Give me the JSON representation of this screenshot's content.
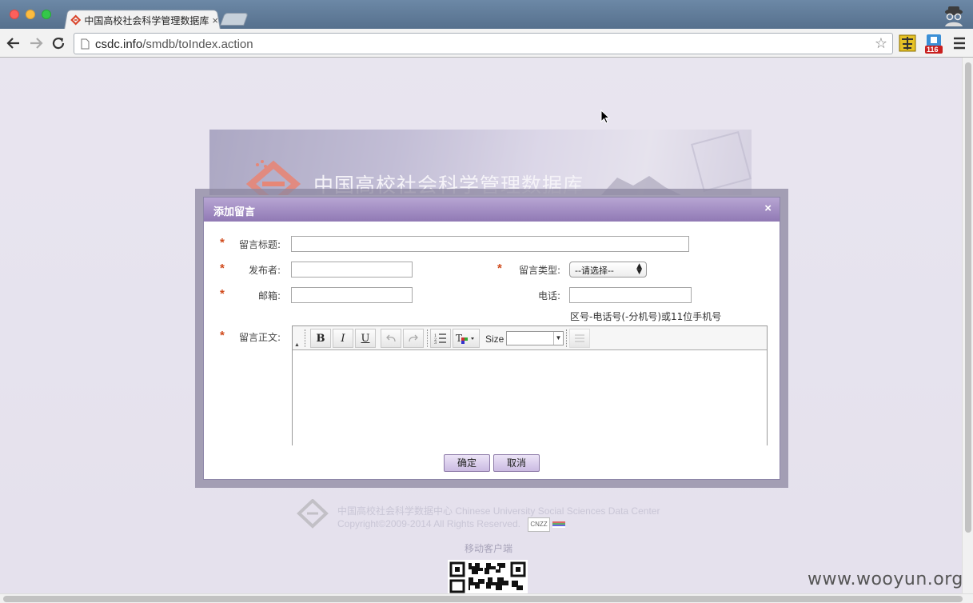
{
  "browser": {
    "tab_title": "中国高校社会科学管理数据库",
    "tab_close": "×",
    "url_host": "csdc.info",
    "url_path": "/smdb/toIndex.action",
    "extension_badge": "116"
  },
  "banner": {
    "title": "中国高校社会科学管理数据库"
  },
  "modal": {
    "title": "添加留言",
    "close": "×",
    "fields": {
      "subject_label": "留言标题:",
      "publisher_label": "发布者:",
      "type_label": "留言类型:",
      "type_value": "--请选择--",
      "email_label": "邮箱:",
      "phone_label": "电话:",
      "phone_hint": "区号-电话号(-分机号)或11位手机号",
      "body_label": "留言正文:",
      "required_mark": "*"
    },
    "editor": {
      "bold": "B",
      "italic": "I",
      "underline": "U",
      "size_label": "Size"
    },
    "buttons": {
      "confirm": "确定",
      "cancel": "取消"
    }
  },
  "footer": {
    "center_name": "中国高校社会科学数据中心 Chinese University Social Sciences Data Center",
    "copyright": "Copyright©2009-2014 All Rights Reserved.",
    "cnzz": "CNZZ",
    "mobile_label": "移动客户端"
  },
  "watermark": "www.wooyun.org",
  "colors": {
    "modal_header": "#9079b4",
    "required": "#d04a1c",
    "titlebar": "#5f7a97"
  }
}
